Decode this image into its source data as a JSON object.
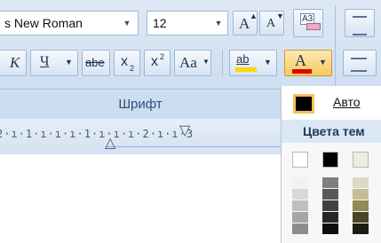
{
  "ribbon": {
    "font_name_value": "s New Roman",
    "font_size_value": "12",
    "grow_font_label": "A",
    "shrink_font_label": "A",
    "clear_formatting_label": "A3",
    "italic_label": "K",
    "underline_label": "Ч",
    "strike_label": "abe",
    "subscript_label": "x",
    "superscript_label": "x",
    "change_case_label": "Aa",
    "highlight_label": "ab",
    "font_color_label": "A",
    "group_label": "Шрифт"
  },
  "ruler": {
    "text": "2·ı·1·ı·ı·ı·1·ı·ı·ı·2·ı·ı·3"
  },
  "color_menu": {
    "auto_label": "Авто",
    "theme_colors_header": "Цвета тем",
    "theme_top_row": [
      "#ffffff",
      "#000000",
      "#eeece1",
      "#1f497d"
    ],
    "theme_columns": [
      [
        "#f2f2f2",
        "#d9d9d9",
        "#bfbfbf",
        "#a6a6a6",
        "#8c8c8c"
      ],
      [
        "#7f7f7f",
        "#595959",
        "#404040",
        "#262626",
        "#0d0d0d"
      ],
      [
        "#ddd9c3",
        "#c4bd97",
        "#938953",
        "#4a442a",
        "#1d1b10"
      ],
      [
        "#c6d9f0",
        "#8db3e2",
        "#548dd4",
        "#17365d",
        "#0f243e"
      ]
    ]
  },
  "colors": {
    "ribbon_bg": "#dfe9f5",
    "font_color_red": "#e00000",
    "highlight_yellow": "#ffd800",
    "auto_swatch_border": "#f1c255"
  }
}
